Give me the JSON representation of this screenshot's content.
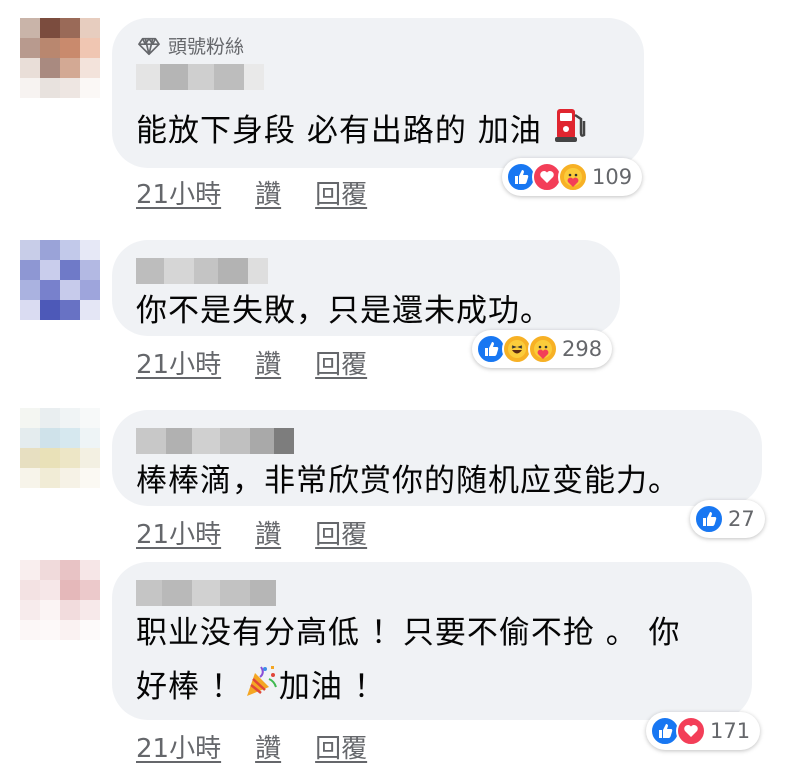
{
  "comments": [
    {
      "badge": "頭號粉絲",
      "text": "能放下身段 必有出路的 加油",
      "time": "21小時",
      "like_label": "讚",
      "reply_label": "回覆",
      "reaction_icons": [
        "like-icon",
        "love-icon",
        "care-icon"
      ],
      "reaction_count": "109"
    },
    {
      "text": "你不是失敗，只是還未成功。",
      "time": "21小時",
      "like_label": "讚",
      "reply_label": "回覆",
      "reaction_icons": [
        "like-icon",
        "haha-icon",
        "care-icon"
      ],
      "reaction_count": "298"
    },
    {
      "text": "棒棒滴，非常欣赏你的随机应变能力。",
      "time": "21小時",
      "like_label": "讚",
      "reply_label": "回覆",
      "reaction_icons": [
        "like-icon"
      ],
      "reaction_count": "27"
    },
    {
      "text_line1": "职业没有分高低 ！只要不偷不抢 。 你",
      "text_line2_a": "好棒 ！",
      "text_line2_b": "加油 ！",
      "time": "21小時",
      "like_label": "讚",
      "reply_label": "回覆",
      "reaction_icons": [
        "like-icon",
        "love-icon"
      ],
      "reaction_count": "171"
    }
  ],
  "colors": {
    "bubble": "#f0f2f5",
    "secondary_text": "#65676b",
    "like": "#1877f2",
    "love": "#f33e58",
    "haha": "#f7b125"
  }
}
